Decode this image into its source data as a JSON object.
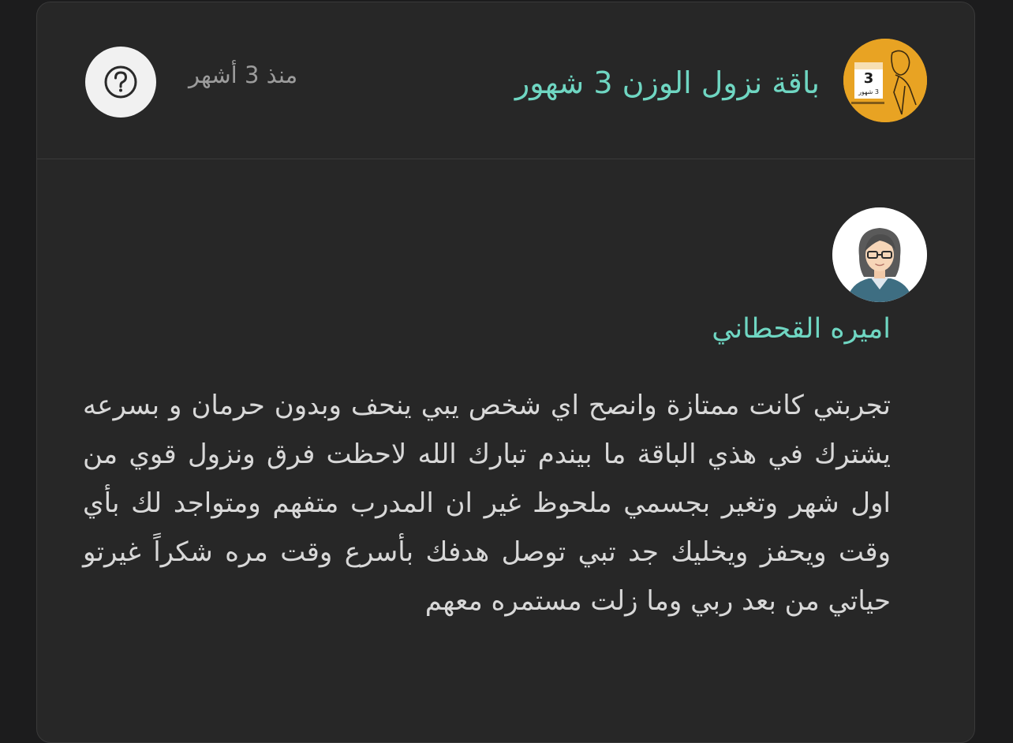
{
  "header": {
    "package_title": "باقة نزول الوزن 3 شهور",
    "time_ago": "منذ 3 أشهر",
    "help_icon": "question-mark-circle-icon",
    "thumbnail_text": "3 شهور"
  },
  "review": {
    "reviewer_name": "اميره القحطاني",
    "avatar_icon": "woman-with-glasses-avatar",
    "text": "تجربتي كانت ممتازة وانصح اي شخص يبي ينحف وبدون حرمان و بسرعه يشترك في هذي الباقة ما بيندم تبارك الله لاحظت فرق ونزول قوي من اول شهر وتغير بجسمي ملحوظ غير ان المدرب متفهم ومتواجد لك بأي وقت ويحفز ويخليك جد تبي توصل هدفك بأسرع وقت مره شكراً غيرتو حياتي من بعد ربي وما زلت مستمره معهم"
  },
  "colors": {
    "background": "#1c1c1d",
    "card": "#272727",
    "accent_teal": "#6fd6c2",
    "muted_text": "#9c9c9c",
    "body_text": "#d8d8d8",
    "thumbnail_yellow": "#e8a323"
  }
}
